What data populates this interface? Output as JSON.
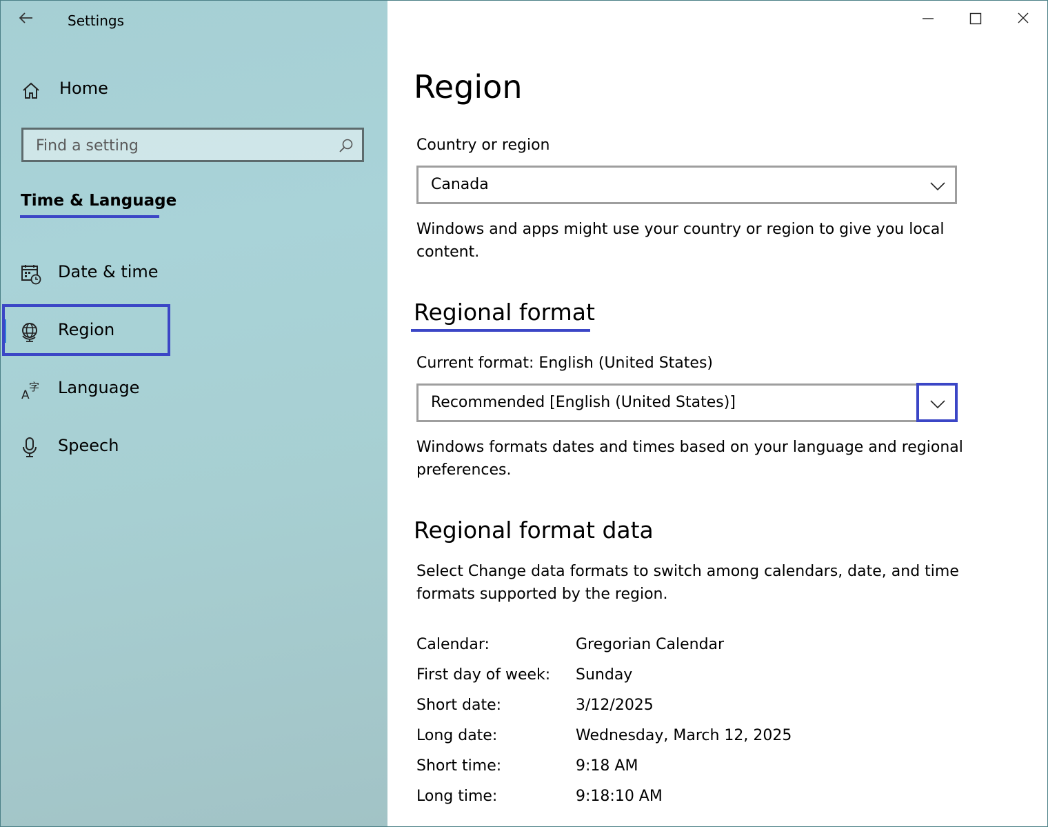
{
  "app": {
    "title": "Settings"
  },
  "sidebar": {
    "home_label": "Home",
    "search_placeholder": "Find a setting",
    "section_title": "Time & Language",
    "items": [
      {
        "label": "Date & time",
        "icon": "calendar-clock-icon"
      },
      {
        "label": "Region",
        "icon": "globe-icon",
        "selected": true
      },
      {
        "label": "Language",
        "icon": "language-icon"
      },
      {
        "label": "Speech",
        "icon": "microphone-icon"
      }
    ]
  },
  "main": {
    "title": "Region",
    "country": {
      "label": "Country or region",
      "value": "Canada",
      "description": "Windows and apps might use your country or region to give you local content."
    },
    "regional_format": {
      "heading": "Regional format",
      "current_label": "Current format: English (United States)",
      "value": "Recommended [English (United States)]",
      "description": "Windows formats dates and times based on your language and regional preferences."
    },
    "format_data": {
      "heading": "Regional format data",
      "description": "Select Change data formats to switch among calendars, date, and time formats supported by the region.",
      "rows": [
        {
          "key": "Calendar:",
          "value": "Gregorian Calendar"
        },
        {
          "key": "First day of week:",
          "value": "Sunday"
        },
        {
          "key": "Short date:",
          "value": "3/12/2025"
        },
        {
          "key": "Long date:",
          "value": "Wednesday, March 12, 2025"
        },
        {
          "key": "Short time:",
          "value": "9:18 AM"
        },
        {
          "key": "Long time:",
          "value": "9:18:10 AM"
        }
      ]
    }
  },
  "colors": {
    "highlight": "#3b46c6",
    "selection": "#2f7fd8"
  }
}
